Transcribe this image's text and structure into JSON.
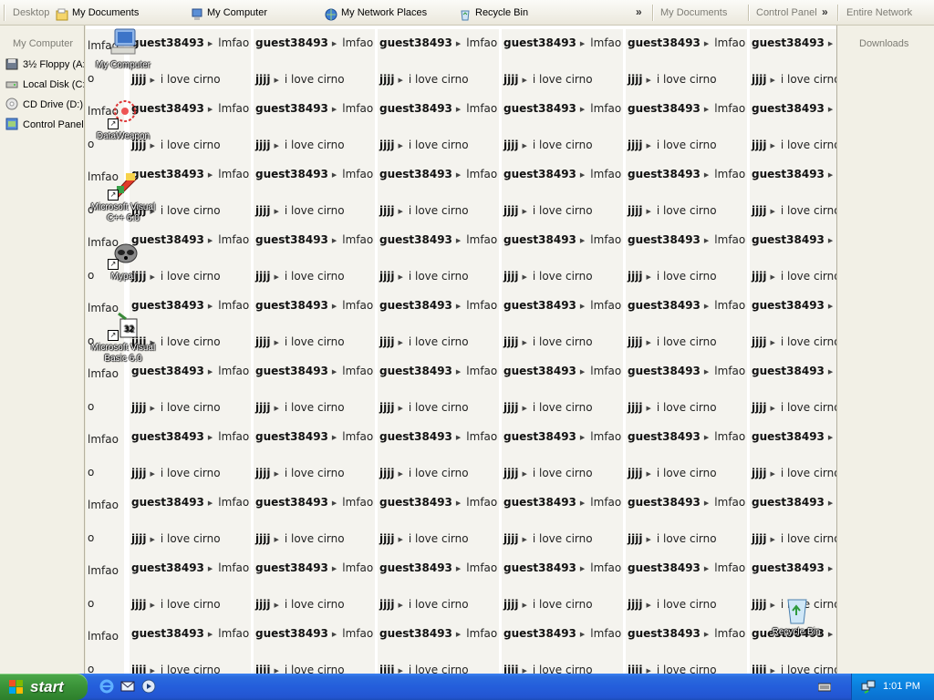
{
  "toolbar": {
    "items": [
      {
        "label": "Desktop",
        "icon": "none"
      },
      {
        "label": "My Documents",
        "icon": "my-documents-icon"
      },
      {
        "label": "My Computer",
        "icon": "my-computer-icon"
      },
      {
        "label": "My Network Places",
        "icon": "network-places-icon"
      },
      {
        "label": "Recycle Bin",
        "icon": "recycle-bin-icon"
      }
    ],
    "links": [
      {
        "label": "My Documents"
      },
      {
        "label": "Control Panel"
      },
      {
        "label": "Entire Network"
      }
    ],
    "chevron": "»"
  },
  "left_panel": {
    "title": "My Computer",
    "items": [
      {
        "label": "3½ Floppy (A:)",
        "icon": "floppy-icon"
      },
      {
        "label": "Local Disk (C:)",
        "icon": "hard-disk-icon"
      },
      {
        "label": "CD Drive (D:)",
        "icon": "cd-drive-icon"
      },
      {
        "label": "Control Panel",
        "icon": "control-panel-icon"
      }
    ]
  },
  "right_panel": {
    "title": "Downloads"
  },
  "grid": {
    "row_a": {
      "bold": "guest38493",
      "text": "lmfao"
    },
    "row_b": {
      "bold": "jjjj",
      "text": "i love cirno"
    },
    "first_col_a": "lmfao",
    "first_col_b": "o"
  },
  "desktop_icons": [
    {
      "label": "My Computer",
      "icon": "my-computer-icon"
    },
    {
      "label": "DataWeapon",
      "icon": "dataweapon-icon"
    },
    {
      "label": "Microsoft Visual C++ 6.0",
      "icon": "visual-cpp-icon"
    },
    {
      "label": "Mypal",
      "icon": "mypal-raccoon-icon"
    },
    {
      "label": "Microsoft Visual Basic 6.0",
      "icon": "visual-basic-icon"
    },
    {
      "label": "Recycle Bin",
      "icon": "recycle-bin-icon"
    }
  ],
  "taskbar": {
    "start_label": "start",
    "quicklaunch": [
      "internet-explorer-icon",
      "outlook-express-icon",
      "media-player-icon"
    ],
    "clock": "1:01 PM"
  },
  "colors": {
    "taskbar_blue": "#245edb",
    "start_green": "#3a9238",
    "tray_blue": "#0b7fdd"
  }
}
